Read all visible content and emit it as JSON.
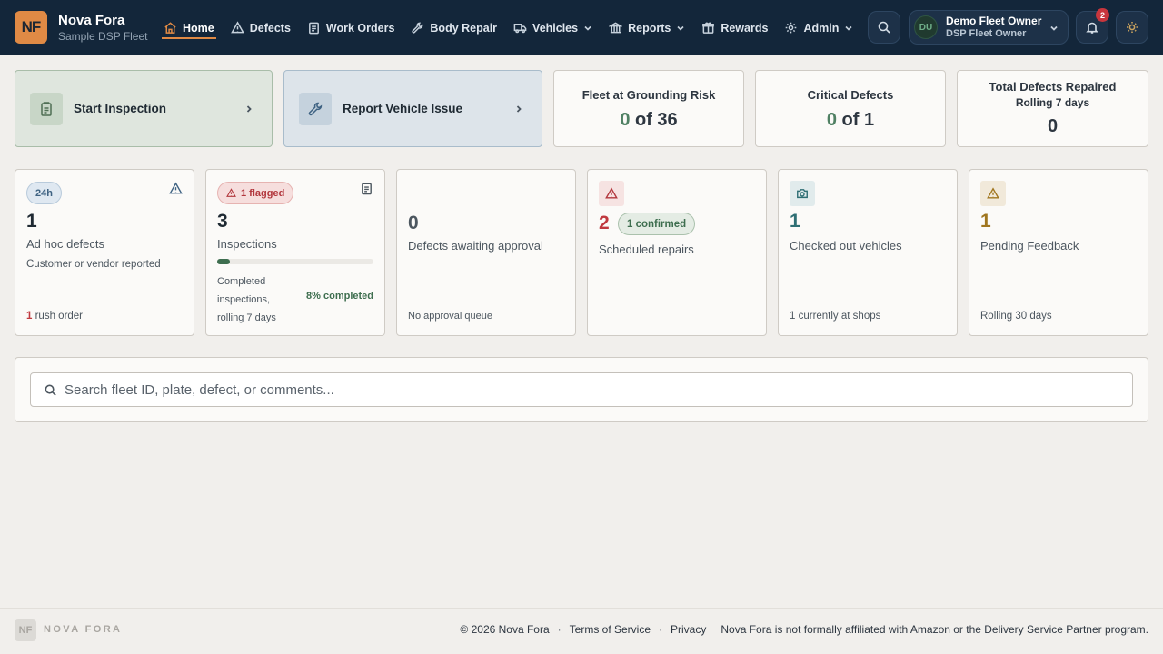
{
  "app": {
    "logo_text": "NF",
    "name": "Nova Fora",
    "fleet": "Sample DSP Fleet"
  },
  "nav": {
    "home": "Home",
    "defects": "Defects",
    "work_orders": "Work Orders",
    "body_repair": "Body Repair",
    "vehicles": "Vehicles",
    "reports": "Reports",
    "rewards": "Rewards",
    "admin": "Admin"
  },
  "user": {
    "initials": "DU",
    "name": "Demo Fleet Owner",
    "role": "DSP Fleet Owner",
    "notifications": "2"
  },
  "actions": {
    "start_inspection": "Start Inspection",
    "report_issue": "Report Vehicle Issue"
  },
  "stats": {
    "grounding": {
      "title": "Fleet at Grounding Risk",
      "count": "0",
      "rest": " of 36"
    },
    "critical": {
      "title": "Critical Defects",
      "count": "0",
      "rest": " of 1"
    },
    "repaired": {
      "title": "Total Defects Repaired",
      "sub": "Rolling 7 days",
      "value": "0"
    }
  },
  "metrics": {
    "adhoc": {
      "badge": "24h",
      "value": "1",
      "label": "Ad hoc defects",
      "sub": "Customer or vendor reported",
      "foot_count": "1",
      "foot_text": " rush order"
    },
    "inspections": {
      "badge": "1 flagged",
      "value": "3",
      "label": "Inspections",
      "progress": 0.08,
      "sub_line1": "Completed",
      "sub_line2": "inspections,",
      "sub_line3": "rolling 7 days",
      "percent_text": "8% completed"
    },
    "approval": {
      "value": "0",
      "label": "Defects awaiting approval",
      "foot": "No approval queue"
    },
    "scheduled": {
      "value": "2",
      "badge": "1 confirmed",
      "label": "Scheduled repairs"
    },
    "checked_out": {
      "value": "1",
      "label": "Checked out vehicles",
      "foot": "1 currently at shops"
    },
    "feedback": {
      "value": "1",
      "label": "Pending Feedback",
      "foot": "Rolling 30 days"
    }
  },
  "search": {
    "placeholder": "Search fleet ID, plate, defect, or comments..."
  },
  "footer": {
    "logo_text": "NF",
    "brand": "NOVA FORA",
    "copyright": "© 2026 Nova Fora",
    "terms": "Terms of Service",
    "privacy": "Privacy",
    "disclaimer": "Nova Fora is not formally affiliated with Amazon or the Delivery Service Partner program."
  },
  "colors": {
    "topbar": "#13263a",
    "accent": "#e08a45",
    "green": "#4f8063",
    "red": "#c0393f",
    "teal": "#2f6f74",
    "amber": "#a0761f"
  }
}
